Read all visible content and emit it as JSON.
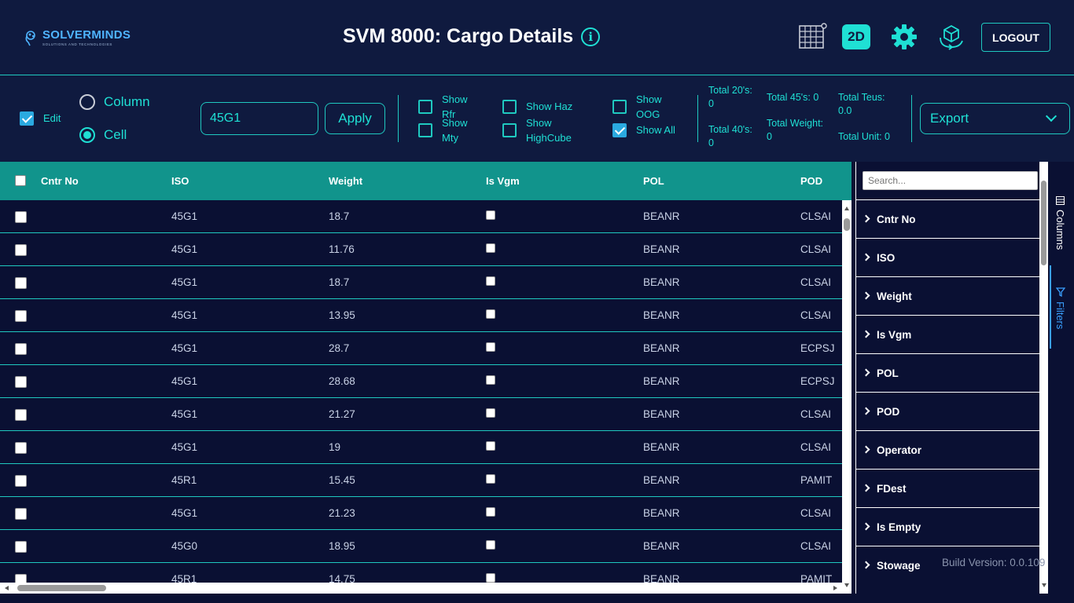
{
  "header": {
    "logo_name": "SOLVERMINDS",
    "logo_sub": "SOLUTIONS AND TECHNOLOGIES",
    "title": "SVM 8000: Cargo Details",
    "info_glyph": "i",
    "badge_2d": "2D",
    "logout": "LOGOUT",
    "accent": "#1fe0d4"
  },
  "toolbar": {
    "edit_label": "Edit",
    "edit_checked": true,
    "radio_column": "Column",
    "radio_cell": "Cell",
    "selected_mode": "Cell",
    "iso_value": "45G1",
    "apply": "Apply",
    "show_rfr_1": "Show",
    "show_rfr_2": "Rfr",
    "show_mty_1": "Show",
    "show_mty_2": "Mty",
    "show_haz": "Show Haz",
    "show_hc_1": "Show",
    "show_hc_2": "HighCube",
    "show_oog_1": "Show",
    "show_oog_2": "OOG",
    "show_all": "Show All",
    "show_all_checked": true,
    "total_20_1": "Total 20's:",
    "total_20_2": "0",
    "total_40_1": "Total 40's:",
    "total_40_2": "0",
    "total_45": "Total 45's: 0",
    "total_weight_1": "Total Weight:",
    "total_weight_2": "0",
    "total_teus_1": "Total Teus:",
    "total_teus_2": "0.0",
    "total_unit": "Total Unit: 0",
    "export": "Export"
  },
  "grid": {
    "columns": [
      "Cntr No",
      "ISO",
      "Weight",
      "Is Vgm",
      "POL",
      "POD"
    ],
    "rows": [
      {
        "iso": "45G1",
        "weight": "18.7",
        "pol": "BEANR",
        "pod": "CLSAI"
      },
      {
        "iso": "45G1",
        "weight": "11.76",
        "pol": "BEANR",
        "pod": "CLSAI"
      },
      {
        "iso": "45G1",
        "weight": "18.7",
        "pol": "BEANR",
        "pod": "CLSAI"
      },
      {
        "iso": "45G1",
        "weight": "13.95",
        "pol": "BEANR",
        "pod": "CLSAI"
      },
      {
        "iso": "45G1",
        "weight": "28.7",
        "pol": "BEANR",
        "pod": "ECPSJ"
      },
      {
        "iso": "45G1",
        "weight": "28.68",
        "pol": "BEANR",
        "pod": "ECPSJ"
      },
      {
        "iso": "45G1",
        "weight": "21.27",
        "pol": "BEANR",
        "pod": "CLSAI"
      },
      {
        "iso": "45G1",
        "weight": "19",
        "pol": "BEANR",
        "pod": "CLSAI"
      },
      {
        "iso": "45R1",
        "weight": "15.45",
        "pol": "BEANR",
        "pod": "PAMIT"
      },
      {
        "iso": "45G1",
        "weight": "21.23",
        "pol": "BEANR",
        "pod": "CLSAI"
      },
      {
        "iso": "45G0",
        "weight": "18.95",
        "pol": "BEANR",
        "pod": "CLSAI"
      },
      {
        "iso": "45R1",
        "weight": "14.75",
        "pol": "BEANR",
        "pod": "PAMIT"
      }
    ]
  },
  "side_panel": {
    "search_placeholder": "Search...",
    "items": [
      "Cntr No",
      "ISO",
      "Weight",
      "Is Vgm",
      "POL",
      "POD",
      "Operator",
      "FDest",
      "Is Empty",
      "Stowage"
    ],
    "tab_columns": "Columns",
    "tab_filters": "Filters",
    "active_tab": "Filters"
  },
  "footer": {
    "build": "Build Version: 0.0.109"
  }
}
